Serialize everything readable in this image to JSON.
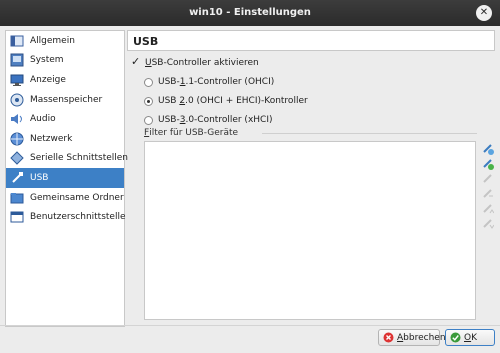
{
  "window": {
    "title": "win10 - Einstellungen"
  },
  "sidebar": {
    "items": [
      {
        "label": "Allgemein",
        "icon": "general-icon"
      },
      {
        "label": "System",
        "icon": "system-icon"
      },
      {
        "label": "Anzeige",
        "icon": "display-icon"
      },
      {
        "label": "Massenspeicher",
        "icon": "storage-icon"
      },
      {
        "label": "Audio",
        "icon": "audio-icon"
      },
      {
        "label": "Netzwerk",
        "icon": "network-icon"
      },
      {
        "label": "Serielle Schnittstellen",
        "icon": "serial-icon"
      },
      {
        "label": "USB",
        "icon": "usb-icon",
        "active": true
      },
      {
        "label": "Gemeinsame Ordner",
        "icon": "shared-folder-icon"
      },
      {
        "label": "Benutzerschnittstelle",
        "icon": "user-interface-icon"
      }
    ]
  },
  "usb": {
    "section_title": "USB",
    "enable_label_prefix": "U",
    "enable_label_rest": "SB-Controller aktivieren",
    "enabled": true,
    "controllers": [
      {
        "pre": "USB-",
        "ul": "1",
        "post": ".1-Controller (OHCI)",
        "checked": false
      },
      {
        "pre": "USB ",
        "ul": "2",
        "post": ".0 (OHCI + EHCI)-Kontroller",
        "checked": true
      },
      {
        "pre": "USB-",
        "ul": "3",
        "post": ".0-Controller (xHCI)",
        "checked": false
      }
    ],
    "filter_label_prefix": "F",
    "filter_label_rest": "ilter für USB-Geräte",
    "filters": []
  },
  "buttons": {
    "cancel_prefix": "A",
    "cancel_rest": "bbrechen",
    "ok_prefix": "O",
    "ok_rest": "K"
  },
  "colors": {
    "accent": "#3d80c6",
    "titlebar": "#2b2b2b"
  }
}
